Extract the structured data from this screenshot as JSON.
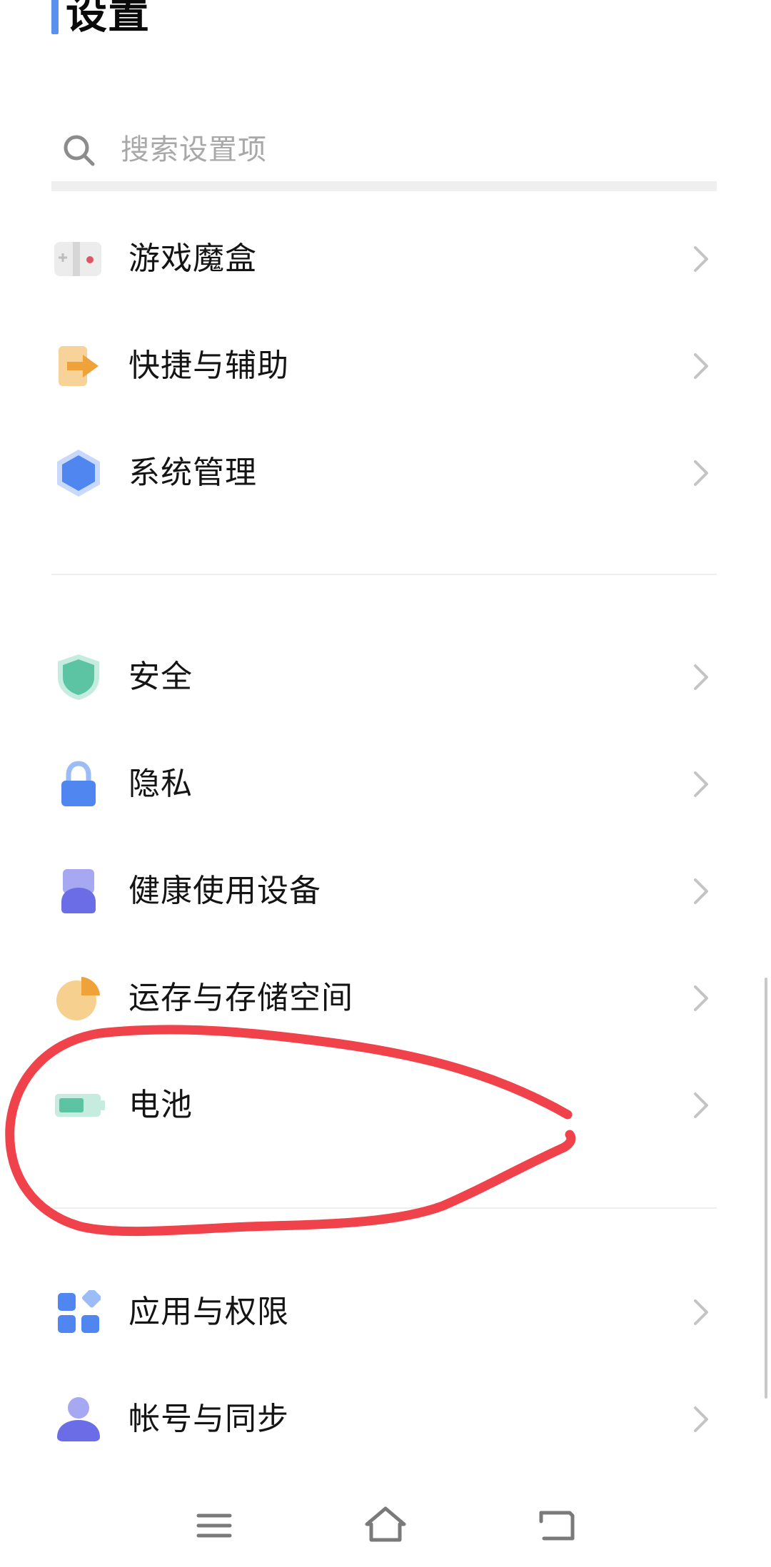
{
  "header": {
    "title": "设置",
    "accent_color": "#5b8ff0"
  },
  "search": {
    "placeholder": "搜索设置项",
    "icon": "search-icon"
  },
  "groups": [
    {
      "items": [
        {
          "label": "游戏魔盒",
          "icon": "game-box-icon"
        },
        {
          "label": "快捷与辅助",
          "icon": "shortcut-arrow-icon"
        },
        {
          "label": "系统管理",
          "icon": "system-hexagon-icon"
        }
      ]
    },
    {
      "items": [
        {
          "label": "安全",
          "icon": "shield-icon"
        },
        {
          "label": "隐私",
          "icon": "lock-icon"
        },
        {
          "label": "健康使用设备",
          "icon": "health-usage-icon"
        },
        {
          "label": "运存与存储空间",
          "icon": "storage-pie-icon"
        },
        {
          "label": "电池",
          "icon": "battery-icon",
          "annotated": true
        }
      ]
    },
    {
      "items": [
        {
          "label": "应用与权限",
          "icon": "apps-grid-icon"
        },
        {
          "label": "帐号与同步",
          "icon": "account-person-icon"
        }
      ]
    }
  ],
  "annotation": {
    "shape": "hand-drawn-loop",
    "color": "#f0424a",
    "target": "电池"
  },
  "navigation_bar": {
    "buttons": [
      "menu-icon",
      "home-icon",
      "back-icon"
    ]
  }
}
